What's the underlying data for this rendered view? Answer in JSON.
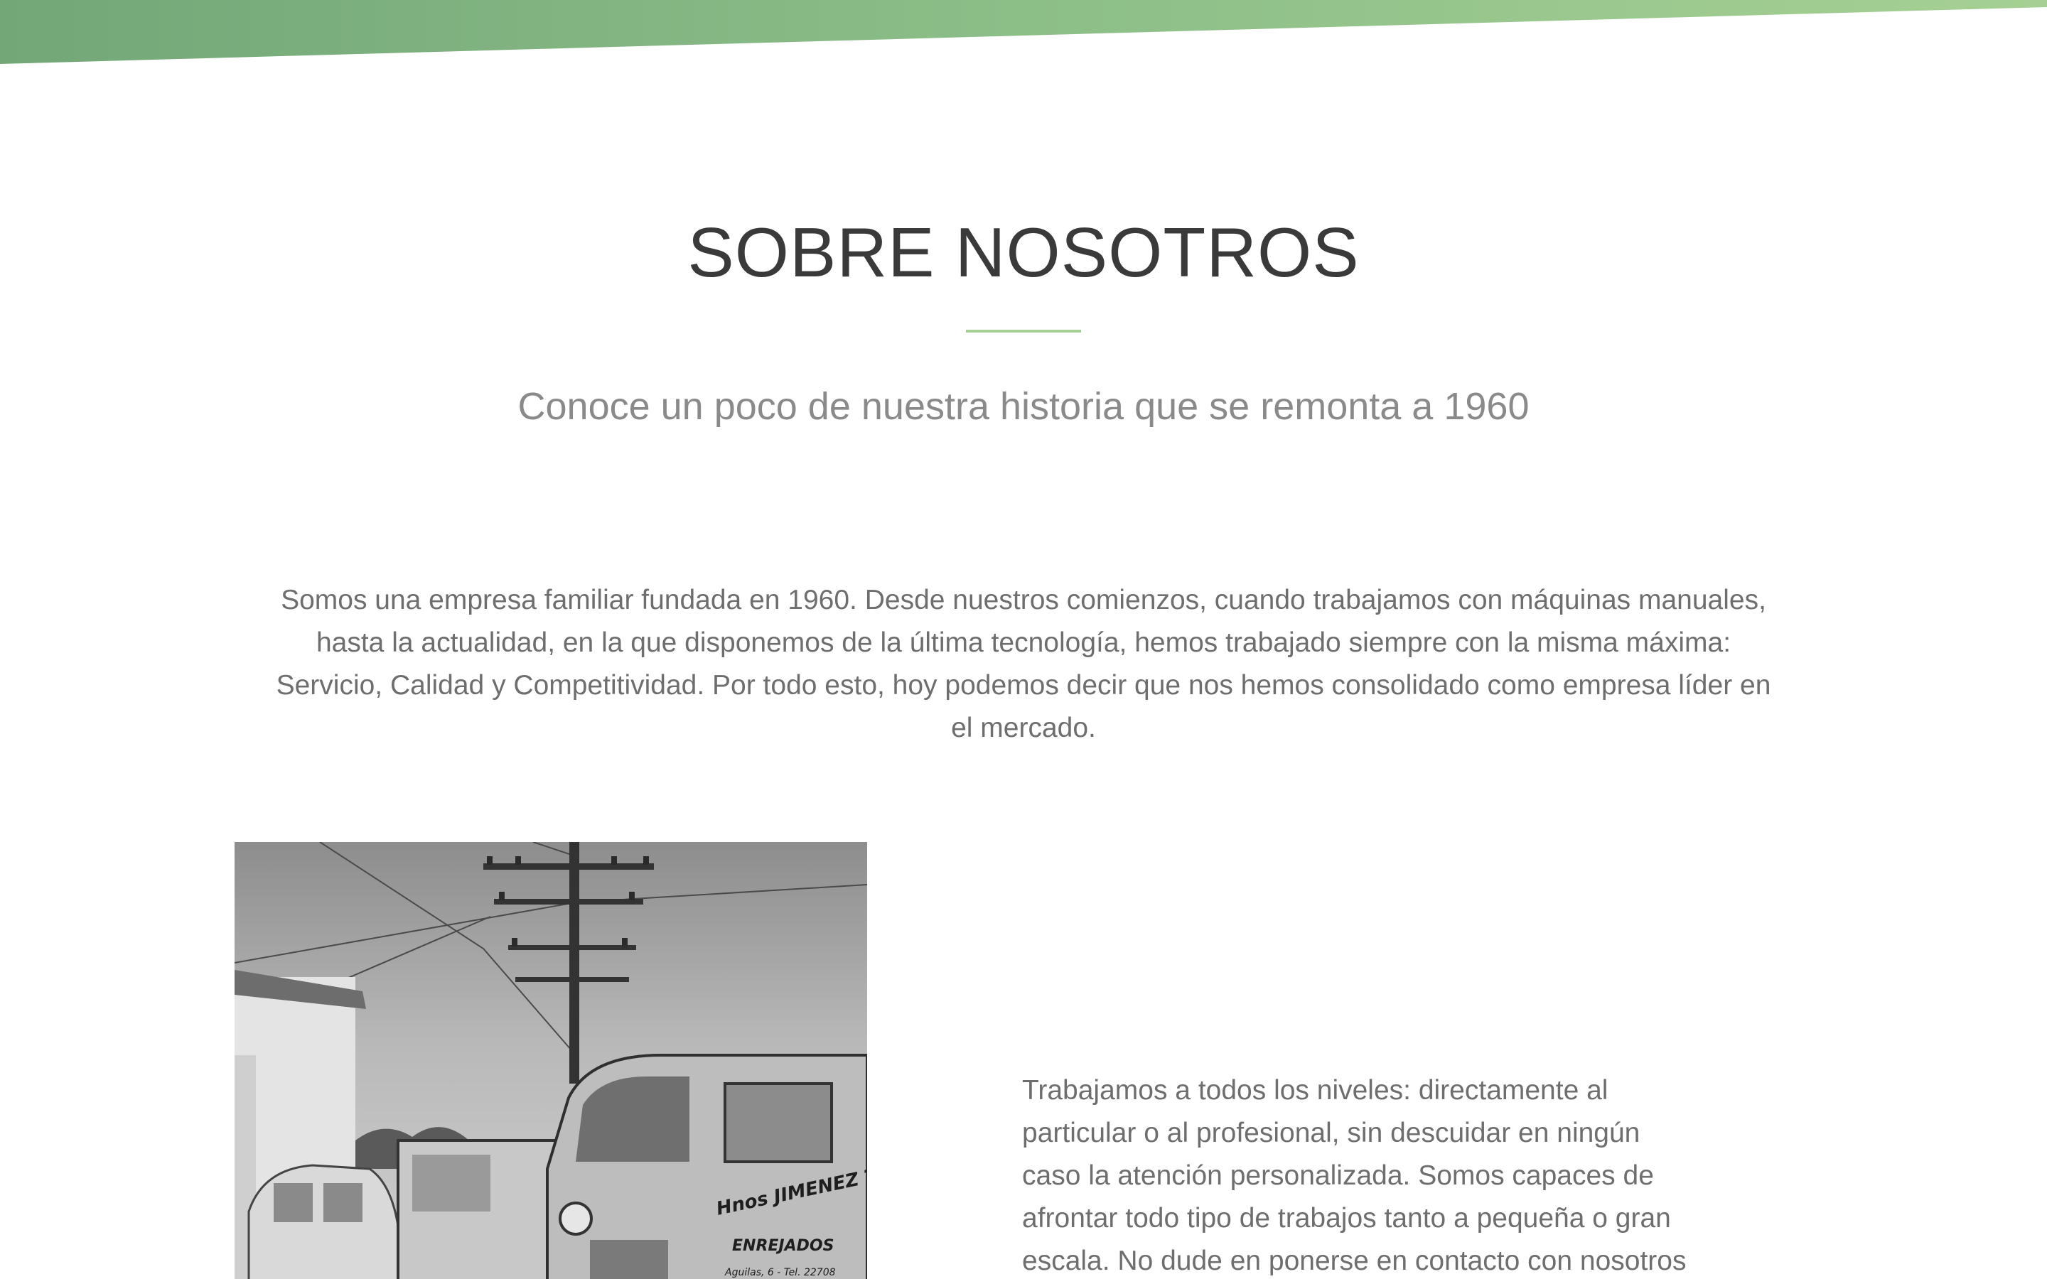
{
  "about": {
    "title": "SOBRE NOSOTROS",
    "subtitle": "Conoce un poco de nuestra historia que se remonta a 1960",
    "intro": "Somos una empresa familiar fundada en 1960. Desde nuestros comienzos, cuando trabajamos con máquinas manuales, hasta la actualidad, en la que disponemos de la última tecnología, hemos trabajado siempre con la misma máxima: Servicio, Calidad y Competitividad. Por todo esto, hoy podemos decir que nos hemos consolidado como empresa líder en el mercado.",
    "services_text": "Trabajamos a todos los niveles: directamente al particular o al profesional, sin descuidar en ningún caso la atención personalizada. Somos capaces de afrontar todo tipo de trabajos tanto a pequeña o gran escala. No dude en ponerse en contacto con nosotros y le prepararemos un"
  },
  "photo": {
    "van_lettering_line1": "Hnos JIMENEZ TOLEDO",
    "van_lettering_line2": "ENREJADOS",
    "van_lettering_line3": "Aguilas, 6 - Tel. 22708"
  },
  "colors": {
    "accent_green": "#a8cf95",
    "band_green_dark": "#75a97a",
    "band_green_light": "#a3cf92",
    "title_text": "#3a3a3a",
    "body_text": "#6e6e6e"
  }
}
